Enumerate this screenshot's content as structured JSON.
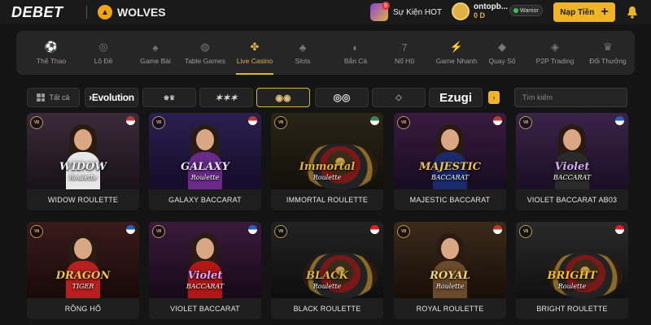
{
  "header": {
    "logo_main": "DEBET",
    "partner": "WOLVES",
    "event_label": "Sự Kiện HOT",
    "event_count": "9",
    "username": "ontopb...",
    "balance": "0 D",
    "rank": "Warrior",
    "deposit_label": "Nạp Tiền"
  },
  "categories": [
    {
      "label": "Thể Thao",
      "icon": "soccer-ball-icon",
      "glyph": "⚽"
    },
    {
      "label": "Lô Đề",
      "icon": "lottery-balls-icon",
      "glyph": "◎"
    },
    {
      "label": "Game Bài",
      "icon": "cards-icon",
      "glyph": "♠"
    },
    {
      "label": "Table Games",
      "icon": "table-games-icon",
      "glyph": "◍"
    },
    {
      "label": "Live Casino",
      "icon": "casino-chip-icon",
      "glyph": "✤"
    },
    {
      "label": "Slots",
      "icon": "cherry-icon",
      "glyph": "♣"
    },
    {
      "label": "Bắn Cá",
      "icon": "fish-icon",
      "glyph": "◐"
    },
    {
      "label": "Nổ Hũ",
      "icon": "seven-icon",
      "glyph": "7"
    },
    {
      "label": "Game Nhanh",
      "icon": "lightning-icon",
      "glyph": "⚡"
    },
    {
      "label": "Quay Số",
      "icon": "ticket-icon",
      "glyph": "◆"
    },
    {
      "label": "P2P Trading",
      "icon": "p2p-icon",
      "glyph": "◈"
    },
    {
      "label": "Đổi Thưởng",
      "icon": "reward-icon",
      "glyph": "♛"
    }
  ],
  "active_category": "Live Casino",
  "providers": {
    "all_label": "Tất cả",
    "evolution": "›Evolution",
    "ezugi": "Ezugi"
  },
  "search": {
    "placeholder": "Tìm kiếm"
  },
  "games": [
    {
      "name": "WIDOW ROULETTE",
      "art": "WIDOW",
      "sub": "Roulette",
      "art_color": "#f0f0f0"
    },
    {
      "name": "GALAXY BACCARAT",
      "art": "GALAXY",
      "sub": "Roulette",
      "art_color": "#e8e0ff"
    },
    {
      "name": "IMMORTAL ROULETTE",
      "art": "Immortal",
      "sub": "Roulette",
      "art_color": "#e0b245"
    },
    {
      "name": "MAJESTIC BACCARAT",
      "art": "MAJESTIC",
      "sub": "BACCARAT",
      "art_color": "#f2c14e"
    },
    {
      "name": "VIOLET BACCARAT AB03",
      "art": "Violet",
      "sub": "BACCARAT",
      "art_color": "#d7a6ff"
    },
    {
      "name": "RỒNG HỔ",
      "art": "DRAGON",
      "sub": "TIGER",
      "art_color": "#f0c04a"
    },
    {
      "name": "VIOLET BACCARAT",
      "art": "Violet",
      "sub": "BACCARAT",
      "art_color": "#d7a6ff"
    },
    {
      "name": "BLACK ROULETTE",
      "art": "BLACK",
      "sub": "Roulette",
      "art_color": "#e0b245"
    },
    {
      "name": "ROYAL ROULETTE",
      "art": "ROYAL",
      "sub": "Roulette",
      "art_color": "#f2d27a"
    },
    {
      "name": "BRIGHT ROULETTE",
      "art": "BRIGHT",
      "sub": "Roulette",
      "art_color": "#f5c030"
    }
  ],
  "colors": {
    "accent": "#e0b245",
    "button": "#f0b32a"
  }
}
